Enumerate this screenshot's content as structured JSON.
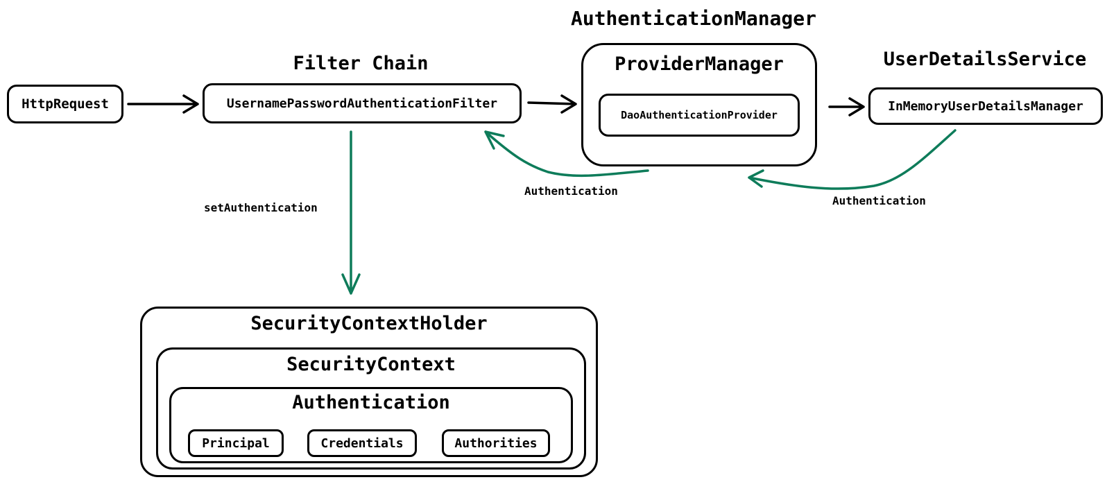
{
  "colors": {
    "stroke": "#000000",
    "accent_arrow": "#0e7c5a",
    "background": "#ffffff"
  },
  "nodes": {
    "http_request": "HttpRequest",
    "filter_chain_title": "Filter Chain",
    "filter": "UsernamePasswordAuthenticationFilter",
    "auth_manager_title": "AuthenticationManager",
    "provider_manager": "ProviderManager",
    "dao_provider": "DaoAuthenticationProvider",
    "user_details_title": "UserDetailsService",
    "in_memory_manager": "InMemoryUserDetailsManager",
    "security_context_holder": "SecurityContextHolder",
    "security_context": "SecurityContext",
    "authentication": "Authentication",
    "principal": "Principal",
    "credentials": "Credentials",
    "authorities": "Authorities"
  },
  "edges": {
    "set_authentication": "setAuthentication",
    "auth_return_1": "Authentication",
    "auth_return_2": "Authentication"
  }
}
